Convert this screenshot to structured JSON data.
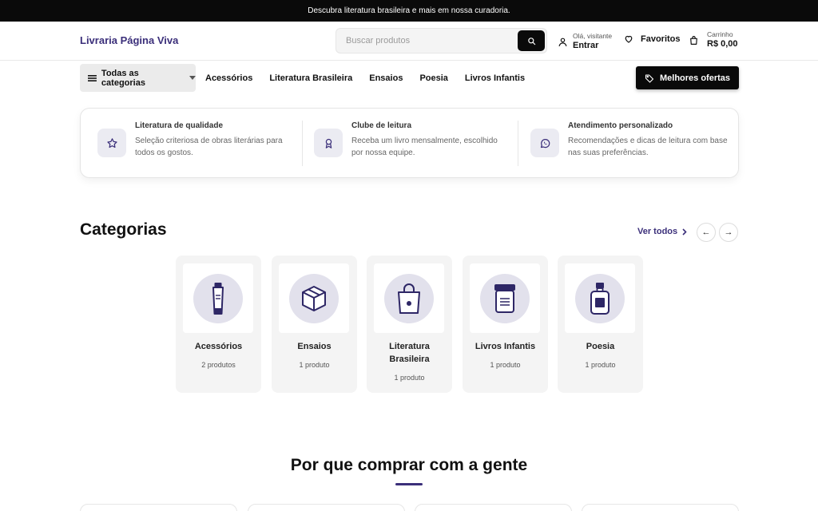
{
  "announcement": "Descubra literatura brasileira e mais em nossa curadoria.",
  "header": {
    "logo": "Livraria Página Viva",
    "search_placeholder": "Buscar produtos",
    "greeting": "Olá, visitante",
    "login": "Entrar",
    "favorites": "Favoritos",
    "cart_label": "Carrinho",
    "cart_total": "R$ 0,00"
  },
  "nav": {
    "all_categories": "Todas as categorias",
    "links": [
      "Acessórios",
      "Literatura Brasileira",
      "Ensaios",
      "Poesia",
      "Livros Infantis"
    ],
    "deals": "Melhores ofertas"
  },
  "features": [
    {
      "icon": "star-icon",
      "title": "Literatura de qualidade",
      "desc": "Seleção criteriosa de obras literárias para todos os gostos."
    },
    {
      "icon": "award-icon",
      "title": "Clube de leitura",
      "desc": "Receba um livro mensalmente, escolhido por nossa equipe."
    },
    {
      "icon": "whatsapp-icon",
      "title": "Atendimento personalizado",
      "desc": "Recomendações e dicas de leitura com base nas suas preferências."
    }
  ],
  "categories": {
    "title": "Categorias",
    "see_all": "Ver todos",
    "prev": "←",
    "next": "→",
    "items": [
      {
        "name": "Acessórios",
        "count": "2 produtos",
        "icon": "tube-icon"
      },
      {
        "name": "Ensaios",
        "count": "1 produto",
        "icon": "box-icon"
      },
      {
        "name": "Literatura Brasileira",
        "count": "1 produto",
        "icon": "bag-icon"
      },
      {
        "name": "Livros Infantis",
        "count": "1 produto",
        "icon": "jar-icon"
      },
      {
        "name": "Poesia",
        "count": "1 produto",
        "icon": "bottle-icon"
      }
    ]
  },
  "why": {
    "title": "Por que comprar com a gente"
  },
  "colors": {
    "brand": "#3b2f7a",
    "dark": "#0a0a0a",
    "icon_bg": "#e2e1ec"
  }
}
